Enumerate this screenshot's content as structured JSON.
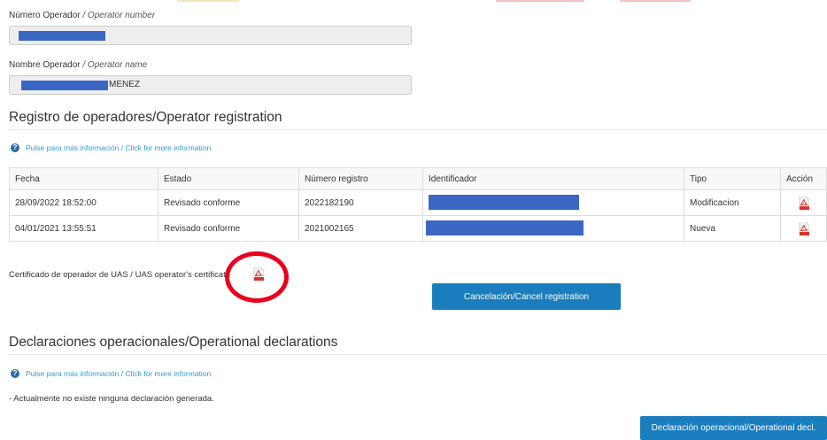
{
  "operator": {
    "number_label": "Número Operador",
    "number_label_en": "/ Operator number",
    "name_label": "Nombre Operador",
    "name_label_en": "/ Operator name",
    "name_visible_suffix": "MENEZ"
  },
  "registration": {
    "title": "Registro de operadores/Operator registration",
    "info_link": "Pulse para más información / Click for more information",
    "columns": [
      "Fecha",
      "Estado",
      "Número registro",
      "Identificador",
      "Tipo",
      "Acción"
    ],
    "rows": [
      {
        "fecha": "28/09/2022 18:52:00",
        "estado": "Revisado conforme",
        "numero": "2022182190",
        "tipo": "Modificacion"
      },
      {
        "fecha": "04/01/2021 13:55:51",
        "estado": "Revisado conforme",
        "numero": "2021002165",
        "tipo": "Nueva"
      }
    ],
    "certificate_label": "Certificado de operador de UAS / UAS operator's certificate",
    "cancel_button": "Cancelación/Cancel registration"
  },
  "declarations": {
    "title": "Declaraciones operacionales/Operational declarations",
    "info_link": "Pulse para más información / Click for more information",
    "empty_message": "- Actualmente no existe ninguna declaración generada.",
    "new_button": "Declaración operacional/Operational decl."
  },
  "colors": {
    "primary_button": "#1a7dbd",
    "link": "#2a9fd6",
    "redaction": "#3a67c4",
    "annotation_circle": "#e8001c",
    "pdf_icon": "#d9342b"
  },
  "icons": {
    "info": "info-circle-icon",
    "pdf": "pdf-file-icon"
  }
}
